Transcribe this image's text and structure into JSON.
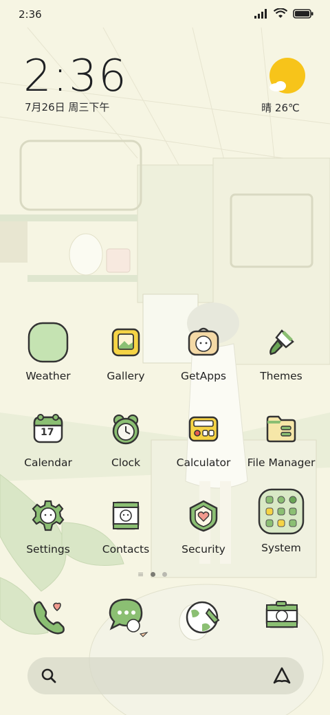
{
  "status_bar": {
    "time": "2:36"
  },
  "clock_widget": {
    "time": "2:36",
    "date": "7月26日 周三下午"
  },
  "weather_widget": {
    "condition_temp": "晴 26℃"
  },
  "apps": [
    {
      "label": "Weather",
      "icon": "weather-icon"
    },
    {
      "label": "Gallery",
      "icon": "gallery-icon"
    },
    {
      "label": "GetApps",
      "icon": "getapps-icon"
    },
    {
      "label": "Themes",
      "icon": "paintbrush-icon"
    },
    {
      "label": "Calendar",
      "icon": "calendar-icon",
      "icon_text": "17"
    },
    {
      "label": "Clock",
      "icon": "clock-icon"
    },
    {
      "label": "Calculator",
      "icon": "calculator-icon"
    },
    {
      "label": "File Manager",
      "icon": "folder-icon"
    },
    {
      "label": "Settings",
      "icon": "gear-icon"
    },
    {
      "label": "Contacts",
      "icon": "contacts-icon"
    },
    {
      "label": "Security",
      "icon": "shield-icon"
    },
    {
      "label": "System",
      "icon": "folder-grid-icon"
    }
  ],
  "page_indicator": {
    "pages": 2,
    "active": 1
  },
  "dock": [
    {
      "icon": "phone-icon"
    },
    {
      "icon": "messages-icon"
    },
    {
      "icon": "browser-icon"
    },
    {
      "icon": "camera-icon"
    }
  ],
  "colors": {
    "accent_green": "#8bbf73",
    "outline": "#333333",
    "sun": "#f7c41a",
    "background": "#f6f5e3"
  }
}
